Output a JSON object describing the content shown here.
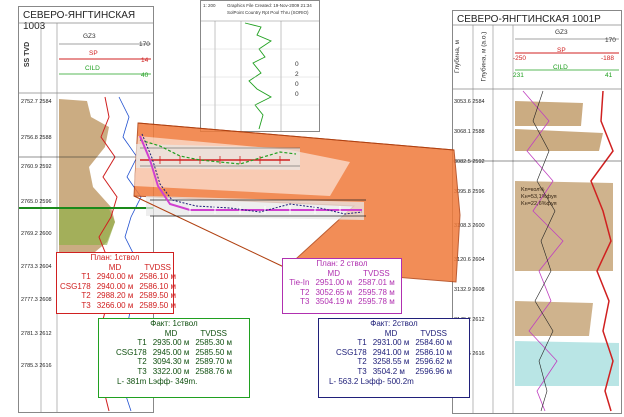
{
  "left_panel": {
    "title": "СЕВЕРО-ЯНГТИНСКАЯ 1003",
    "header": {
      "gz": "GZ3",
      "scale_right": "170",
      "tvd_label": "SS TVD",
      "sp": "SP",
      "sp_right": "14",
      "cild": "CILD",
      "cild_right": "40"
    },
    "depths": [
      "2752.7 2584",
      "2756.8 2588",
      "2760.9 2592",
      "2765.0 2596",
      "2769.2 2600",
      "2773.3 2604",
      "2777.3 2608",
      "2781.3 2612",
      "2785.3 2616"
    ]
  },
  "right_panel": {
    "title": "СЕВЕРО-ЯНГТИНСКАЯ 1001Р",
    "header": {
      "col1": "Глубина, м",
      "col2": "Глубина, м (а.о.)",
      "gz": "GZ3",
      "scale_right": "170",
      "sp": "SP",
      "sp_left": "-250",
      "sp_right": "-188",
      "cild": "CILD",
      "cild_left": "231",
      "cild_right": "41"
    },
    "depths": [
      "3053.6 2584",
      "3068.1 2588",
      "3082.5 2592",
      "3095.8 2596",
      "3108.3 2600",
      "3120.6 2604",
      "3132.9 2608",
      "3145.2 2612",
      "3157.5 2616"
    ],
    "annotation": [
      "Kп=кол%",
      "Kн=53,1%фуя",
      "Kн=22,6%фуя"
    ]
  },
  "center_plot": {
    "header_text": "Graphics File Created: 19-Nov-2009 21:34",
    "header_left": "1: 200",
    "header_sub": "SolPoint Country Rpt  Pool Thru (SORIO)",
    "tick_labels": [
      "0",
      "2",
      "0",
      "0"
    ]
  },
  "plan1": {
    "title": "План: 1ствол",
    "headers": [
      "MD",
      "TVDSS"
    ],
    "rows": [
      [
        "T1",
        "2940.00 м",
        "2586.10 м"
      ],
      [
        "CSG178",
        "2940.00 м",
        "2586.10 м"
      ],
      [
        "T2",
        "2988.20 м",
        "2589.50 м"
      ],
      [
        "T3",
        "3266.00 м",
        "2589.50 м"
      ]
    ]
  },
  "plan2": {
    "title": "План: 2 ствол",
    "headers": [
      "MD",
      "TVDSS"
    ],
    "rows": [
      [
        "Tie-In",
        "2951.00 м",
        "2587.01 м"
      ],
      [
        "T2",
        "3052.65 м",
        "2595.78 м"
      ],
      [
        "T3",
        "3504.19 м",
        "2595.78 м"
      ]
    ]
  },
  "fact1": {
    "title": "Факт: 1ствол",
    "headers": [
      "MD",
      "TVDSS"
    ],
    "rows": [
      [
        "T1",
        "2935.00 м",
        "2585.30 м"
      ],
      [
        "CSG178",
        "2945.00 м",
        "2585.50 м"
      ],
      [
        "T2",
        "3094.30 м",
        "2589.70 м"
      ],
      [
        "T3",
        "3322.00 м",
        "2588.76 м"
      ]
    ],
    "footer": "L- 381m  Lэфф- 349m."
  },
  "fact2": {
    "title": "Факт: 2ствол",
    "headers": [
      "MD",
      "TVDSS"
    ],
    "rows": [
      [
        "T1",
        "2931.00 м",
        "2584.60 м"
      ],
      [
        "CSG178",
        "2941.00 м",
        "2586.10 м"
      ],
      [
        "T2",
        "3258.55 м",
        "2596.62 м"
      ],
      [
        "T3",
        "3504.2 м",
        "2596.96 м"
      ]
    ],
    "footer": "L- 563.2  Lэфф- 500.2m"
  },
  "colors": {
    "plan1": "#d02020",
    "plan2": "#b030b0",
    "fact1": "#20a020",
    "fact2": "#20207a",
    "reservoir": "#f07a3a",
    "sand": "#a0681c"
  }
}
